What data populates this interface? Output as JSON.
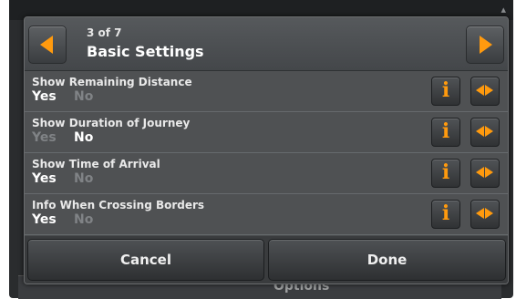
{
  "header": {
    "page_count": "3 of 7",
    "title": "Basic Settings"
  },
  "settings": [
    {
      "label": "Show Remaining Distance",
      "yes": "Yes",
      "no": "No",
      "value": "Yes"
    },
    {
      "label": "Show Duration of Journey",
      "yes": "Yes",
      "no": "No",
      "value": "No"
    },
    {
      "label": "Show Time of Arrival",
      "yes": "Yes",
      "no": "No",
      "value": "Yes"
    },
    {
      "label": "Info When Crossing Borders",
      "yes": "Yes",
      "no": "No",
      "value": "Yes"
    }
  ],
  "footer": {
    "cancel_label": "Cancel",
    "done_label": "Done"
  },
  "background": {
    "under_label": "Options"
  },
  "colors": {
    "accent": "#ff9a0e",
    "dialog_bg": "#4a4c4e"
  },
  "icons": {
    "prev": "left-arrow-icon",
    "next": "right-arrow-icon",
    "info": "info-icon",
    "toggle": "toggle-arrows-icon"
  }
}
